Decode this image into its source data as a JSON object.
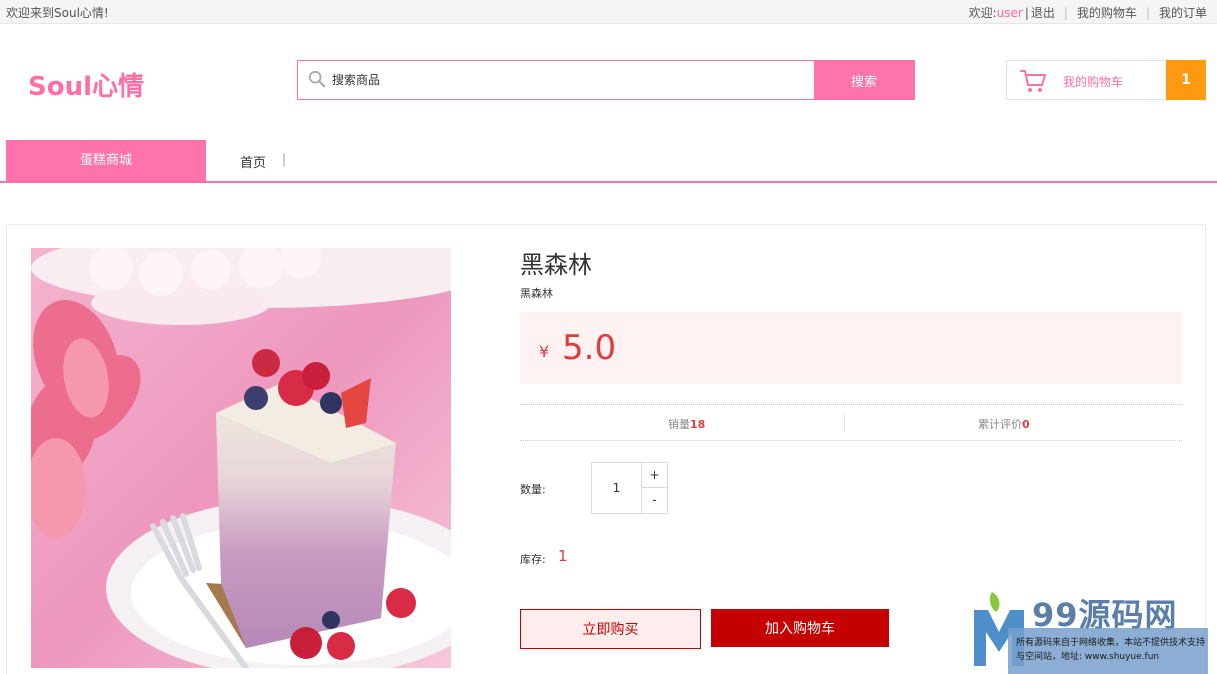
{
  "topbar": {
    "welcome": "欢迎来到Soul心情!",
    "greeting": "欢迎:",
    "username": "user",
    "divider": "|",
    "logout": "退出",
    "my_cart": "我的购物车",
    "my_orders": "我的订单"
  },
  "header": {
    "logo": "Soul心情",
    "search_placeholder": "搜索商品",
    "search_button": "搜索",
    "cart_label": "我的购物车",
    "cart_count": "1"
  },
  "nav": {
    "category": "蛋糕商城",
    "home": "首页",
    "separator": "|"
  },
  "product": {
    "name": "黑森林",
    "subtitle": "黑森林",
    "currency": "¥",
    "price": "5.0",
    "sales_label": "销量",
    "sales_value": "18",
    "reviews_label": "累计评价",
    "reviews_value": "0",
    "quantity_label": "数量:",
    "quantity_value": "1",
    "plus": "+",
    "minus": "-",
    "stock_label": "库存:",
    "stock_value": "1",
    "buy_now": "立即购买",
    "add_to_cart": "加入购物车"
  },
  "watermark": {
    "title": "99源码网",
    "text": "所有源码来自于网络收集，本站不提供技术支持与空间站，地址: www.shuyue.fun"
  },
  "colors": {
    "brand_pink": "#ff73ab",
    "price_red": "#e13c3c",
    "button_red": "#c40000",
    "cart_orange": "#ff9910"
  }
}
